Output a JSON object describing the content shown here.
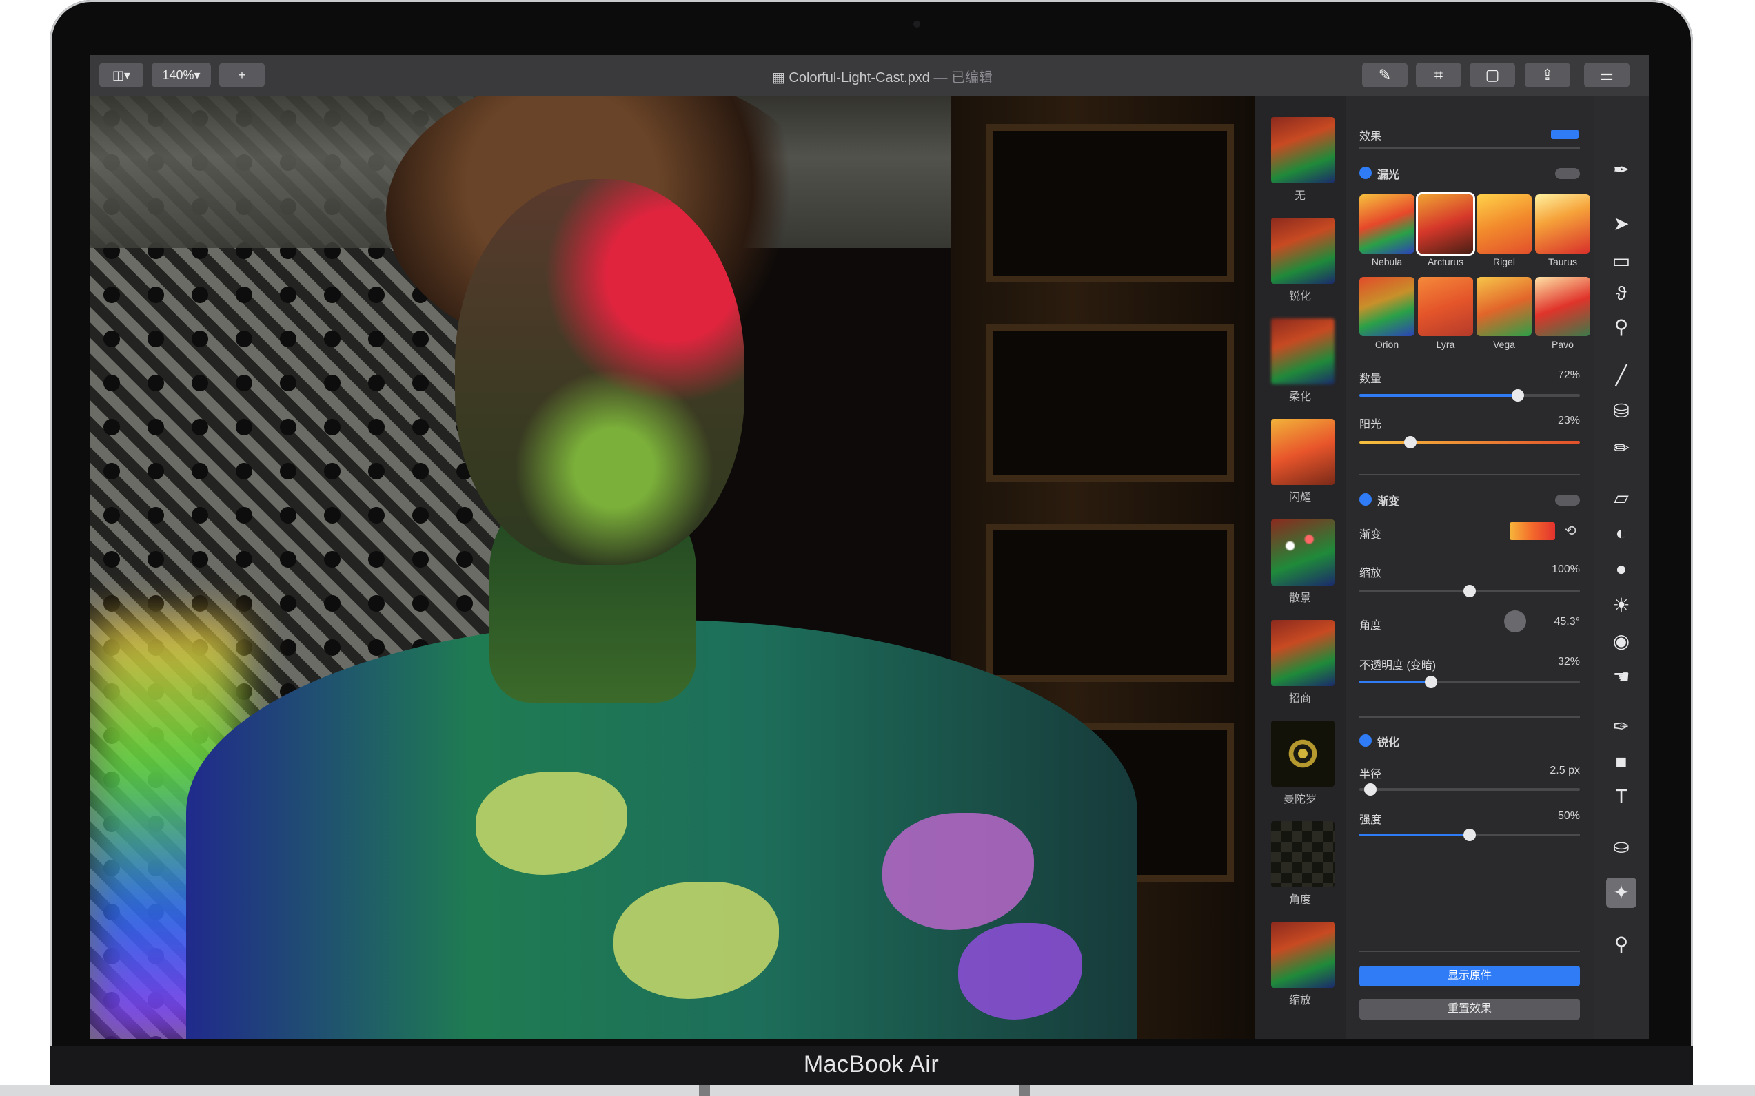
{
  "device": {
    "label": "MacBook Air"
  },
  "toolbar": {
    "layout_button": "◫▾",
    "zoom": "140%▾",
    "add_button": "+",
    "document_name": "Colorful-Light-Cast.pxd",
    "document_status": "— 已编辑",
    "right_icons": [
      "brush-icon",
      "crop-icon",
      "document-icon",
      "share-icon",
      "adjust-icon"
    ]
  },
  "thumbnails": [
    {
      "label": "无"
    },
    {
      "label": "锐化"
    },
    {
      "label": "柔化"
    },
    {
      "label": "闪耀"
    },
    {
      "label": "散景"
    },
    {
      "label": "招商"
    },
    {
      "label": "曼陀罗"
    },
    {
      "label": "角度"
    },
    {
      "label": "缩放"
    }
  ],
  "effects": {
    "header": "效果",
    "light_leak": {
      "title": "漏光",
      "presets_row1": [
        "Nebula",
        "Arcturus",
        "Rigel",
        "Taurus"
      ],
      "presets_row2": [
        "Orion",
        "Lyra",
        "Vega",
        "Pavo"
      ],
      "selected": "Arcturus",
      "amount": {
        "label": "数量",
        "value": "72%",
        "level": 0.72
      },
      "sunlight": {
        "label": "阳光",
        "value": "23%",
        "level": 0.23
      }
    },
    "gradient": {
      "title": "渐变",
      "gradient_label": "渐变",
      "scale": {
        "label": "缩放",
        "value": "100%",
        "level": 0.5
      },
      "angle": {
        "label": "角度",
        "value": "45.3°"
      },
      "opacity": {
        "label": "不透明度 (变暗)",
        "value": "32%",
        "level": 0.32
      }
    },
    "sharpen": {
      "title": "锐化",
      "radius": {
        "label": "半径",
        "value": "2.5 px",
        "level": 0.05
      },
      "intensity": {
        "label": "强度",
        "value": "50%",
        "level": 0.5
      }
    },
    "show_original_button": "显示原件",
    "reset_button": "重置效果"
  },
  "tools": [
    "pen-tool-icon",
    "arrow-icon",
    "select-rect-icon",
    "lasso-icon",
    "magic-wand-icon",
    "brush-icon",
    "bucket-icon",
    "pencil-icon",
    "eraser-icon",
    "clone-icon",
    "blur-icon",
    "sun-icon",
    "sphere-icon",
    "smudge-icon",
    "pen-icon",
    "shape-icon",
    "text-icon",
    "paint-bucket-icon",
    "effects-icon",
    "zoom-icon"
  ],
  "colors": {
    "accent": "#2f7cf6",
    "panel": "#2a2a2c",
    "toolbar": "#3a3a3d"
  }
}
